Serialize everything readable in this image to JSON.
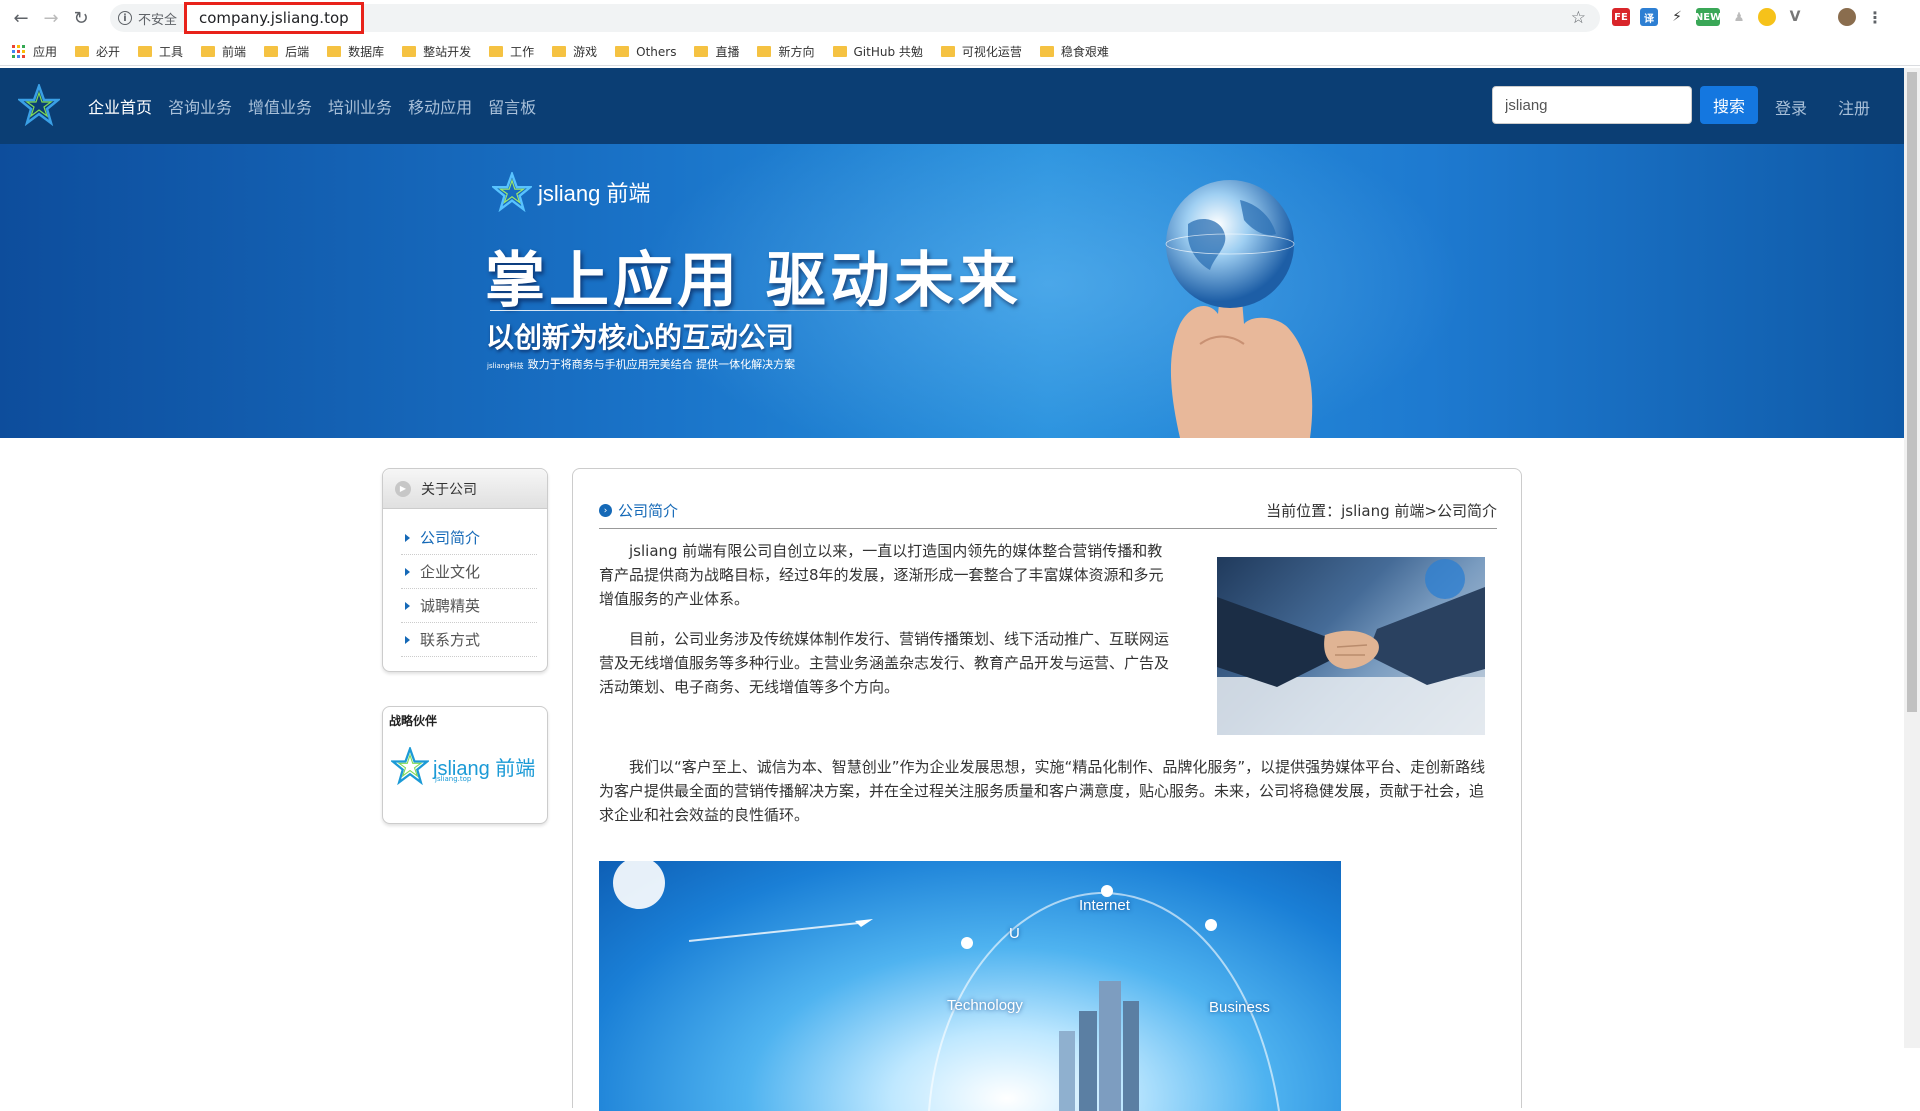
{
  "browser": {
    "insecure_label": "不安全",
    "url": "company.jsliang.top",
    "bookmarks": [
      "应用",
      "必开",
      "工具",
      "前端",
      "后端",
      "数据库",
      "整站开发",
      "工作",
      "游戏",
      "Others",
      "直播",
      "新方向",
      "GitHub 共勉",
      "可视化运营",
      "稳食艰难"
    ]
  },
  "nav": {
    "items": [
      "企业首页",
      "咨询业务",
      "增值业务",
      "培训业务",
      "移动应用",
      "留言板"
    ],
    "search_value": "jsliang",
    "search_button": "搜索",
    "login": "登录",
    "register": "注册"
  },
  "banner": {
    "brand": "jsliang 前端",
    "title": "掌上应用  驱动未来",
    "subtitle": "以创新为核心的互动公司",
    "tagline_small": "jsliang科技",
    "tagline": "致力于将商务与手机应用完美结合  提供一体化解决方案"
  },
  "sidebar": {
    "header": "关于公司",
    "items": [
      "公司简介",
      "企业文化",
      "诚聘精英",
      "联系方式"
    ],
    "partner_title": "战略伙伴",
    "partner_logo_text": "jsliang 前端",
    "partner_logo_small": "jsliang.top"
  },
  "main": {
    "title": "公司简介",
    "breadcrumb": "当前位置：jsliang 前端>公司简介",
    "paragraphs": [
      "jsliang 前端有限公司自创立以来，一直以打造国内领先的媒体整合营销传播和教育产品提供商为战略目标，经过8年的发展，逐渐形成一套整合了丰富媒体资源和多元增值服务的产业体系。",
      "目前，公司业务涉及传统媒体制作发行、营销传播策划、线下活动推广、互联网运营及无线增值服务等多种行业。主营业务涵盖杂志发行、教育产品开发与运营、广告及活动策划、电子商务、无线增值等多个方向。",
      "我们以“客户至上、诚信为本、智慧创业”作为企业发展思想，实施“精品化制作、品牌化服务”，以提供强势媒体平台、走创新路线为客户提供最全面的营销传播解决方案，并在全过程关注服务质量和客户满意度，贴心服务。未来，公司将稳健发展，贡献于社会，追求企业和社会效益的良性循环。"
    ],
    "tech_labels": [
      "Internet",
      "U",
      "Technology",
      "Business"
    ]
  },
  "colors": {
    "nav_bg": "#0b3e74",
    "accent": "#1569b7",
    "search_btn": "#1477e0",
    "url_highlight": "#e8221a"
  }
}
